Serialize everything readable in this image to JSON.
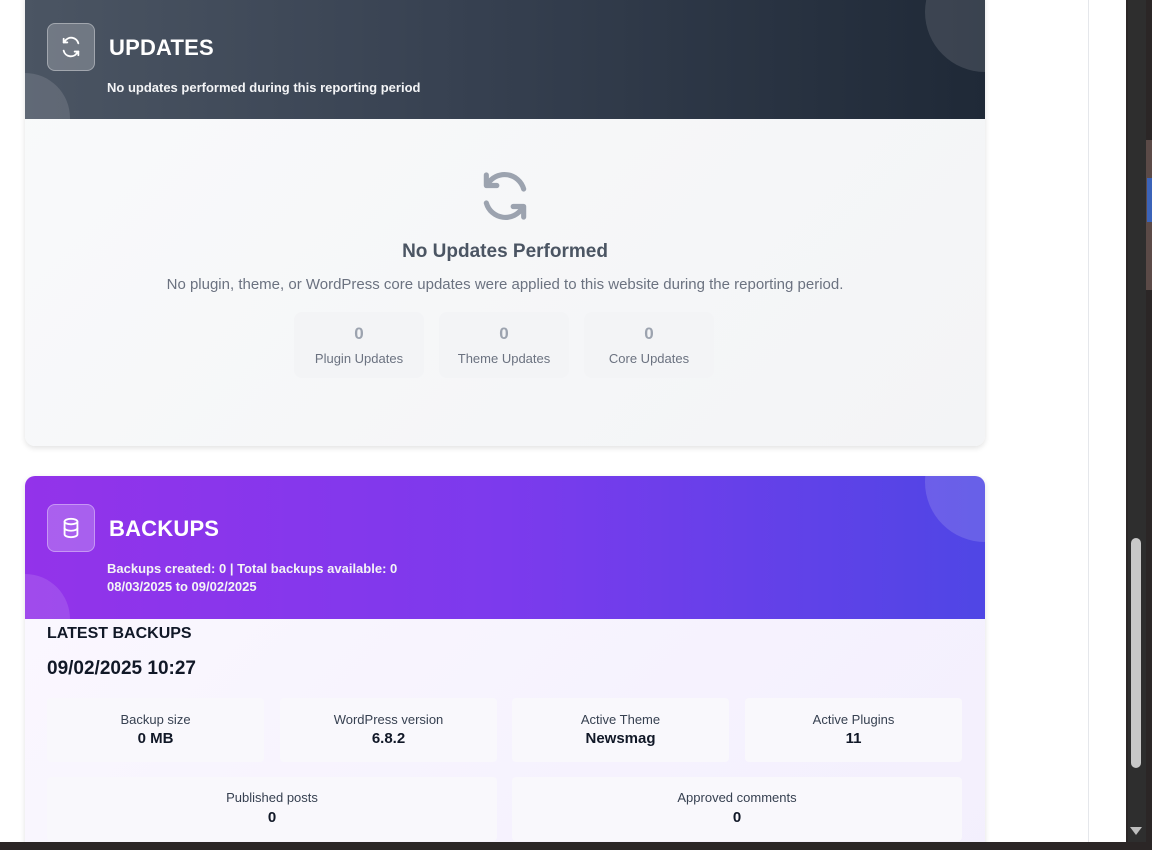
{
  "updates": {
    "title": "UPDATES",
    "subtitle": "No updates performed during this reporting period",
    "header_icon": "refresh-icon",
    "empty_title": "No Updates Performed",
    "empty_description": "No plugin, theme, or WordPress core updates were applied to this website during the reporting period.",
    "stats": [
      {
        "value": "0",
        "label": "Plugin Updates"
      },
      {
        "value": "0",
        "label": "Theme Updates"
      },
      {
        "value": "0",
        "label": "Core Updates"
      }
    ]
  },
  "backups": {
    "title": "BACKUPS",
    "header_icon": "database-icon",
    "summary": "Backups created: 0 | Total backups available: 0",
    "date_range": "08/03/2025 to 09/02/2025",
    "latest_label": "LATEST BACKUPS",
    "latest_date": "09/02/2025 10:27",
    "info": [
      {
        "label": "Backup size",
        "value": "0 MB"
      },
      {
        "label": "WordPress version",
        "value": "6.8.2"
      },
      {
        "label": "Active Theme",
        "value": "Newsmag"
      },
      {
        "label": "Active Plugins",
        "value": "11"
      },
      {
        "label": "Published posts",
        "value": "0"
      },
      {
        "label": "Approved comments",
        "value": "0"
      }
    ]
  },
  "colors": {
    "updates_header_start": "#4b5563",
    "updates_header_end": "#1f2937",
    "backups_header_start": "#9333ea",
    "backups_header_end": "#4f46e5"
  }
}
